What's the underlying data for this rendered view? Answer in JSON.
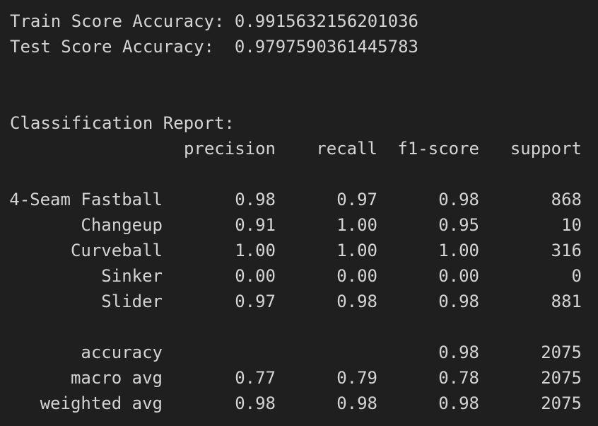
{
  "scores": {
    "train_label": "Train Score Accuracy:",
    "train_value": "0.9915632156201036",
    "test_label": "Test Score Accuracy:",
    "test_value": "0.9797590361445783"
  },
  "report": {
    "title": "Classification Report:",
    "headers": [
      "precision",
      "recall",
      "f1-score",
      "support"
    ],
    "classes": [
      {
        "label": "4-Seam Fastball",
        "precision": "0.98",
        "recall": "0.97",
        "f1": "0.98",
        "support": "868"
      },
      {
        "label": "Changeup",
        "precision": "0.91",
        "recall": "1.00",
        "f1": "0.95",
        "support": "10"
      },
      {
        "label": "Curveball",
        "precision": "1.00",
        "recall": "1.00",
        "f1": "1.00",
        "support": "316"
      },
      {
        "label": "Sinker",
        "precision": "0.00",
        "recall": "0.00",
        "f1": "0.00",
        "support": "0"
      },
      {
        "label": "Slider",
        "precision": "0.97",
        "recall": "0.98",
        "f1": "0.98",
        "support": "881"
      }
    ],
    "summary": [
      {
        "label": "accuracy",
        "precision": "",
        "recall": "",
        "f1": "0.98",
        "support": "2075"
      },
      {
        "label": "macro avg",
        "precision": "0.77",
        "recall": "0.79",
        "f1": "0.78",
        "support": "2075"
      },
      {
        "label": "weighted avg",
        "precision": "0.98",
        "recall": "0.98",
        "f1": "0.98",
        "support": "2075"
      }
    ]
  }
}
